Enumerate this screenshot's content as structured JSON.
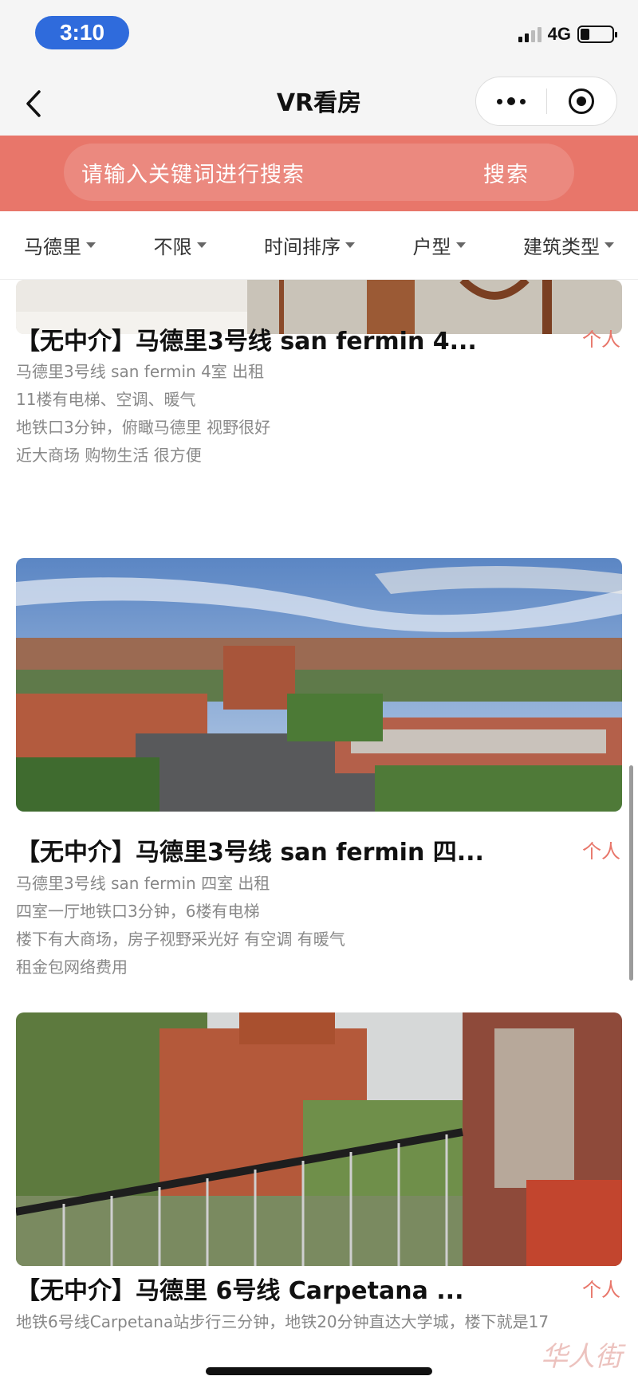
{
  "status_bar": {
    "time": "3:10",
    "network": "4G"
  },
  "nav": {
    "title": "VR看房"
  },
  "search": {
    "placeholder": "请输入关键词进行搜索",
    "button_label": "搜索"
  },
  "filters": [
    {
      "label": "马德里"
    },
    {
      "label": "不限"
    },
    {
      "label": "时间排序"
    },
    {
      "label": "户型"
    },
    {
      "label": "建筑类型"
    }
  ],
  "listings": [
    {
      "title": "【无中介】马德里3号线 san fermin 4...",
      "tag": "个人",
      "lines": [
        "马德里3号线 san fermin 4室 出租",
        "11楼有电梯、空调、暖气",
        "地铁口3分钟，俯瞰马德里 视野很好",
        "近大商场 购物生活 很方便"
      ]
    },
    {
      "title": "【无中介】马德里3号线 san fermin 四...",
      "tag": "个人",
      "lines": [
        "马德里3号线 san fermin 四室 出租",
        "四室一厅地铁口3分钟，6楼有电梯",
        "楼下有大商场，房子视野采光好 有空调 有暖气",
        "租金包网络费用"
      ]
    },
    {
      "title": "【无中介】马德里 6号线 Carpetana ...",
      "tag": "个人",
      "lines": [
        "地铁6号线Carpetana站步行三分钟，地铁20分钟直达大学城，楼下就是17"
      ]
    }
  ],
  "watermark": "华人街",
  "colors": {
    "accent": "#e8766a",
    "time_pill": "#2f6bdc"
  }
}
